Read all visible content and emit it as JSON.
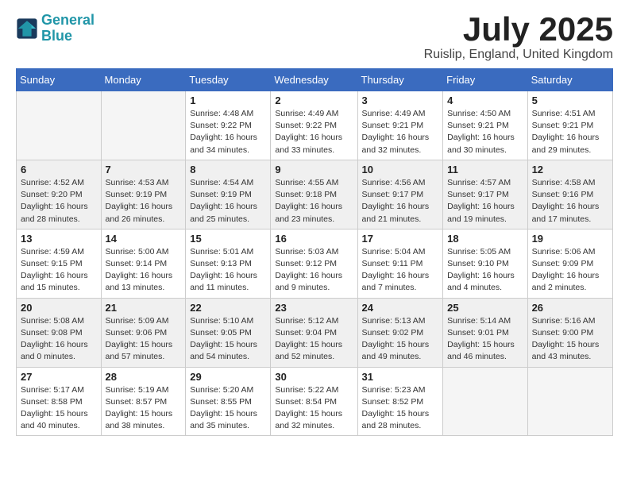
{
  "logo": {
    "line1": "General",
    "line2": "Blue"
  },
  "title": "July 2025",
  "location": "Ruislip, England, United Kingdom",
  "days_of_week": [
    "Sunday",
    "Monday",
    "Tuesday",
    "Wednesday",
    "Thursday",
    "Friday",
    "Saturday"
  ],
  "weeks": [
    [
      {
        "day": "",
        "detail": ""
      },
      {
        "day": "",
        "detail": ""
      },
      {
        "day": "1",
        "detail": "Sunrise: 4:48 AM\nSunset: 9:22 PM\nDaylight: 16 hours\nand 34 minutes."
      },
      {
        "day": "2",
        "detail": "Sunrise: 4:49 AM\nSunset: 9:22 PM\nDaylight: 16 hours\nand 33 minutes."
      },
      {
        "day": "3",
        "detail": "Sunrise: 4:49 AM\nSunset: 9:21 PM\nDaylight: 16 hours\nand 32 minutes."
      },
      {
        "day": "4",
        "detail": "Sunrise: 4:50 AM\nSunset: 9:21 PM\nDaylight: 16 hours\nand 30 minutes."
      },
      {
        "day": "5",
        "detail": "Sunrise: 4:51 AM\nSunset: 9:21 PM\nDaylight: 16 hours\nand 29 minutes."
      }
    ],
    [
      {
        "day": "6",
        "detail": "Sunrise: 4:52 AM\nSunset: 9:20 PM\nDaylight: 16 hours\nand 28 minutes."
      },
      {
        "day": "7",
        "detail": "Sunrise: 4:53 AM\nSunset: 9:19 PM\nDaylight: 16 hours\nand 26 minutes."
      },
      {
        "day": "8",
        "detail": "Sunrise: 4:54 AM\nSunset: 9:19 PM\nDaylight: 16 hours\nand 25 minutes."
      },
      {
        "day": "9",
        "detail": "Sunrise: 4:55 AM\nSunset: 9:18 PM\nDaylight: 16 hours\nand 23 minutes."
      },
      {
        "day": "10",
        "detail": "Sunrise: 4:56 AM\nSunset: 9:17 PM\nDaylight: 16 hours\nand 21 minutes."
      },
      {
        "day": "11",
        "detail": "Sunrise: 4:57 AM\nSunset: 9:17 PM\nDaylight: 16 hours\nand 19 minutes."
      },
      {
        "day": "12",
        "detail": "Sunrise: 4:58 AM\nSunset: 9:16 PM\nDaylight: 16 hours\nand 17 minutes."
      }
    ],
    [
      {
        "day": "13",
        "detail": "Sunrise: 4:59 AM\nSunset: 9:15 PM\nDaylight: 16 hours\nand 15 minutes."
      },
      {
        "day": "14",
        "detail": "Sunrise: 5:00 AM\nSunset: 9:14 PM\nDaylight: 16 hours\nand 13 minutes."
      },
      {
        "day": "15",
        "detail": "Sunrise: 5:01 AM\nSunset: 9:13 PM\nDaylight: 16 hours\nand 11 minutes."
      },
      {
        "day": "16",
        "detail": "Sunrise: 5:03 AM\nSunset: 9:12 PM\nDaylight: 16 hours\nand 9 minutes."
      },
      {
        "day": "17",
        "detail": "Sunrise: 5:04 AM\nSunset: 9:11 PM\nDaylight: 16 hours\nand 7 minutes."
      },
      {
        "day": "18",
        "detail": "Sunrise: 5:05 AM\nSunset: 9:10 PM\nDaylight: 16 hours\nand 4 minutes."
      },
      {
        "day": "19",
        "detail": "Sunrise: 5:06 AM\nSunset: 9:09 PM\nDaylight: 16 hours\nand 2 minutes."
      }
    ],
    [
      {
        "day": "20",
        "detail": "Sunrise: 5:08 AM\nSunset: 9:08 PM\nDaylight: 16 hours\nand 0 minutes."
      },
      {
        "day": "21",
        "detail": "Sunrise: 5:09 AM\nSunset: 9:06 PM\nDaylight: 15 hours\nand 57 minutes."
      },
      {
        "day": "22",
        "detail": "Sunrise: 5:10 AM\nSunset: 9:05 PM\nDaylight: 15 hours\nand 54 minutes."
      },
      {
        "day": "23",
        "detail": "Sunrise: 5:12 AM\nSunset: 9:04 PM\nDaylight: 15 hours\nand 52 minutes."
      },
      {
        "day": "24",
        "detail": "Sunrise: 5:13 AM\nSunset: 9:02 PM\nDaylight: 15 hours\nand 49 minutes."
      },
      {
        "day": "25",
        "detail": "Sunrise: 5:14 AM\nSunset: 9:01 PM\nDaylight: 15 hours\nand 46 minutes."
      },
      {
        "day": "26",
        "detail": "Sunrise: 5:16 AM\nSunset: 9:00 PM\nDaylight: 15 hours\nand 43 minutes."
      }
    ],
    [
      {
        "day": "27",
        "detail": "Sunrise: 5:17 AM\nSunset: 8:58 PM\nDaylight: 15 hours\nand 40 minutes."
      },
      {
        "day": "28",
        "detail": "Sunrise: 5:19 AM\nSunset: 8:57 PM\nDaylight: 15 hours\nand 38 minutes."
      },
      {
        "day": "29",
        "detail": "Sunrise: 5:20 AM\nSunset: 8:55 PM\nDaylight: 15 hours\nand 35 minutes."
      },
      {
        "day": "30",
        "detail": "Sunrise: 5:22 AM\nSunset: 8:54 PM\nDaylight: 15 hours\nand 32 minutes."
      },
      {
        "day": "31",
        "detail": "Sunrise: 5:23 AM\nSunset: 8:52 PM\nDaylight: 15 hours\nand 28 minutes."
      },
      {
        "day": "",
        "detail": ""
      },
      {
        "day": "",
        "detail": ""
      }
    ]
  ]
}
